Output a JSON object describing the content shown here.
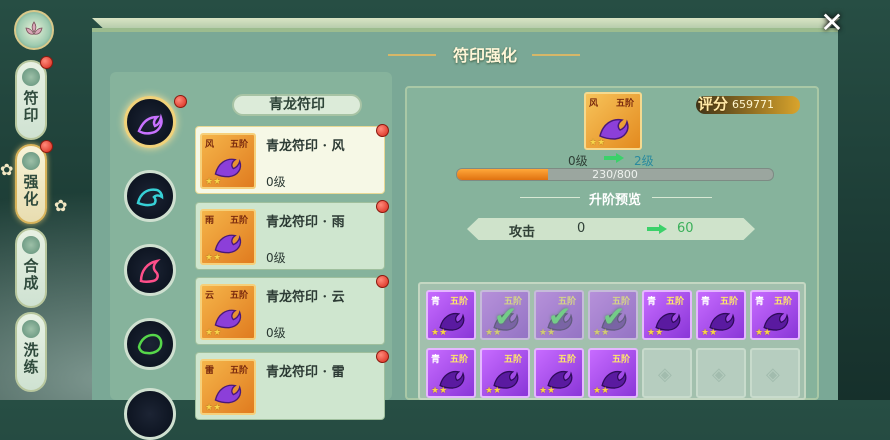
{
  "nav": {
    "tabs": [
      {
        "label": "符印",
        "active": false
      },
      {
        "label": "强化",
        "active": true
      },
      {
        "label": "合成",
        "active": false
      },
      {
        "label": "洗练",
        "active": false
      }
    ]
  },
  "panel": {
    "title": "符印强化",
    "close_icon": "close-x-icon"
  },
  "list": {
    "header": "青龙符印",
    "items": [
      {
        "name": "青龙符印 · 风",
        "tag": "风",
        "grade": "五阶",
        "level": "0级",
        "selected": true
      },
      {
        "name": "青龙符印 · 雨",
        "tag": "雨",
        "grade": "五阶",
        "level": "0级",
        "selected": false
      },
      {
        "name": "青龙符印 · 云",
        "tag": "云",
        "grade": "五阶",
        "level": "0级",
        "selected": false
      },
      {
        "name": "青龙符印 · 雷",
        "tag": "雷",
        "grade": "五阶",
        "level": "",
        "selected": false
      }
    ]
  },
  "detail": {
    "tag": "风",
    "grade": "五阶",
    "score_label": "评分",
    "score_value": "659771",
    "level_from": "0级",
    "level_to": "2级",
    "progress_text": "230/800",
    "progress_current": 230,
    "progress_max": 800,
    "preview_title": "升阶预览",
    "stat_name": "攻击",
    "stat_value": "0",
    "stat_new": "60"
  },
  "materials": [
    {
      "tag": "青",
      "grade": "五阶",
      "checked": false
    },
    {
      "tag": "",
      "grade": "五阶",
      "checked": true
    },
    {
      "tag": "",
      "grade": "五阶",
      "checked": true
    },
    {
      "tag": "",
      "grade": "五阶",
      "checked": true
    },
    {
      "tag": "青",
      "grade": "五阶",
      "checked": false
    },
    {
      "tag": "青",
      "grade": "五阶",
      "checked": false
    },
    {
      "tag": "青",
      "grade": "五阶",
      "checked": false
    },
    {
      "tag": "青",
      "grade": "五阶",
      "checked": false
    },
    {
      "tag": "",
      "grade": "五阶",
      "checked": false
    },
    {
      "tag": "",
      "grade": "五阶",
      "checked": false
    },
    {
      "tag": "",
      "grade": "五阶",
      "checked": false
    },
    null,
    null,
    null
  ],
  "colors": {
    "accent_gold": "#d6b768",
    "progress": "#f08a1f",
    "check_green": "#4fd66a"
  }
}
